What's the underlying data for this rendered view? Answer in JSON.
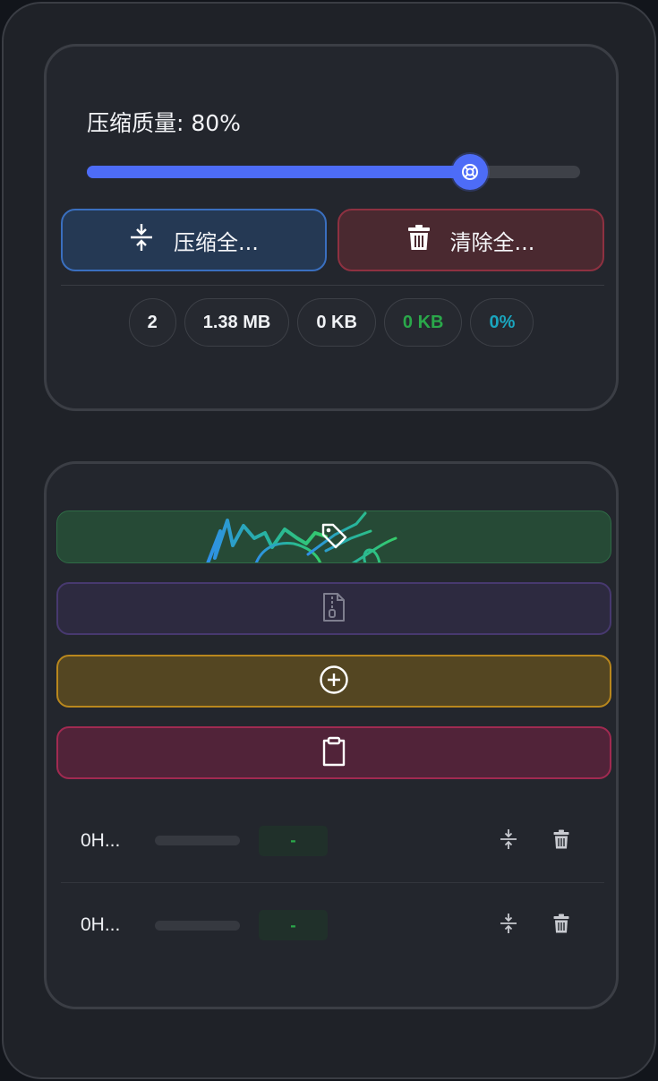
{
  "settings": {
    "quality_label": "压缩质量: 80%",
    "quality_value": 0.8
  },
  "actions": {
    "compress_all_label": "压缩全...",
    "clear_all_label": "清除全..."
  },
  "stats": {
    "file_count": "2",
    "original_size": "1.38 MB",
    "compressed_size": "0 KB",
    "saved_size": "0 KB",
    "saved_percent": "0%"
  },
  "drop_zones": [
    {
      "icon": "tag-icon",
      "color": "#2f6b46"
    },
    {
      "icon": "zip-file-icon",
      "color": "#47396f"
    },
    {
      "icon": "plus-circle-icon",
      "color": "#b9871d"
    },
    {
      "icon": "clipboard-icon",
      "color": "#a12a51"
    }
  ],
  "files": [
    {
      "name": "0H...",
      "saved": "-"
    },
    {
      "name": "0H...",
      "saved": "-"
    }
  ],
  "colors": {
    "accent": "#4d6cf7",
    "success": "#2aa84a",
    "info": "#1aa5be",
    "danger": "#8e3141"
  }
}
